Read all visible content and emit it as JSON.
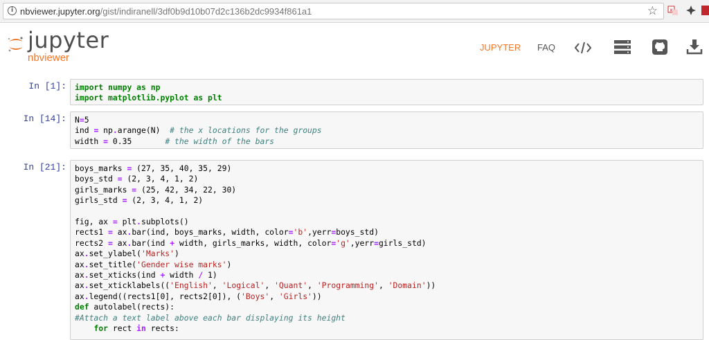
{
  "browser": {
    "url_host": "nbviewer.jupyter.org",
    "url_path": "/gist/indiranell/3df0b9d10b07d2c136b2dc9934f861a1"
  },
  "header": {
    "logo_text": "jupyter",
    "logo_sub": "nbviewer",
    "nav": {
      "jupyter": "JUPYTER",
      "faq": "FAQ"
    },
    "accent_color": "#f37626"
  },
  "cells": [
    {
      "prompt": "In [1]:",
      "lines": [
        "import numpy as np",
        "import matplotlib.pyplot as plt"
      ]
    },
    {
      "prompt": "In [14]:",
      "lines": [
        "N=5",
        "ind = np.arange(N)  # the x locations for the groups",
        "width = 0.35       # the width of the bars"
      ]
    },
    {
      "prompt": "In [21]:",
      "lines": [
        "boys_marks = (27, 35, 40, 35, 29)",
        "boys_std = (2, 3, 4, 1, 2)",
        "girls_marks = (25, 42, 34, 22, 30)",
        "girls_std = (2, 3, 4, 1, 2)",
        "",
        "fig, ax = plt.subplots()",
        "rects1 = ax.bar(ind, boys_marks, width, color='b',yerr=boys_std)",
        "rects2 = ax.bar(ind + width, girls_marks, width, color='g',yerr=girls_std)",
        "ax.set_ylabel('Marks')",
        "ax.set_title('Gender wise marks')",
        "ax.set_xticks(ind + width / 1)",
        "ax.set_xticklabels(('English', 'Logical', 'Quant', 'Programming', 'Domain'))",
        "ax.legend((rects1[0], rects2[0]), ('Boys', 'Girls'))",
        "def autolabel(rects):",
        "#Attach a text label above each bar displaying its height",
        "    for rect in rects:"
      ]
    }
  ]
}
